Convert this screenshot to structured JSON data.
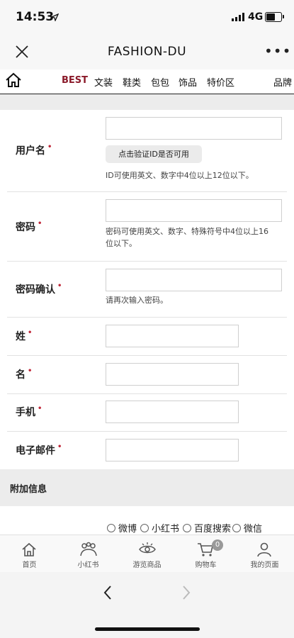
{
  "status": {
    "time": "14:53",
    "location_icon": "location-arrow-icon",
    "network": "4G"
  },
  "navbar": {
    "title": "FASHION-DU",
    "more": "•••"
  },
  "categories": {
    "items": [
      "BEST",
      "文装",
      "鞋类",
      "包包",
      "饰品",
      "特价区",
      "品牌"
    ],
    "active": "BEST",
    "active_color": "#8b1a2a"
  },
  "form": {
    "username": {
      "label": "用户名",
      "required": "•",
      "check_button": "点击验证ID是否可用",
      "hint": "ID可使用英文、数字中4位以上12位以下。"
    },
    "password": {
      "label": "密码",
      "required": "•",
      "hint1": "密码可使用英文、数字、特殊符号中4位以上16",
      "hint2": "位以下。"
    },
    "password_confirm": {
      "label": "密码确认",
      "required": "•",
      "hint": "请再次输入密码。"
    },
    "last_name": {
      "label": "姓",
      "required": "•"
    },
    "first_name": {
      "label": "名",
      "required": "•"
    },
    "mobile": {
      "label": "手机",
      "required": "•"
    },
    "email": {
      "label": "电子邮件",
      "required": "•"
    }
  },
  "extra": {
    "title": "附加信息",
    "options": [
      "微博",
      "小红书",
      "百度搜索",
      "微信"
    ]
  },
  "tabbar": {
    "items": [
      {
        "label": "首页",
        "icon": "home-icon"
      },
      {
        "label": "小红书",
        "icon": "xiaohongshu-icon"
      },
      {
        "label": "游览商品",
        "icon": "eye-icon"
      },
      {
        "label": "购物车",
        "icon": "cart-icon",
        "badge": "0"
      },
      {
        "label": "我的页面",
        "icon": "user-icon"
      }
    ]
  },
  "colors": {
    "required": "#c0293a",
    "accent": "#8b1a2a"
  }
}
